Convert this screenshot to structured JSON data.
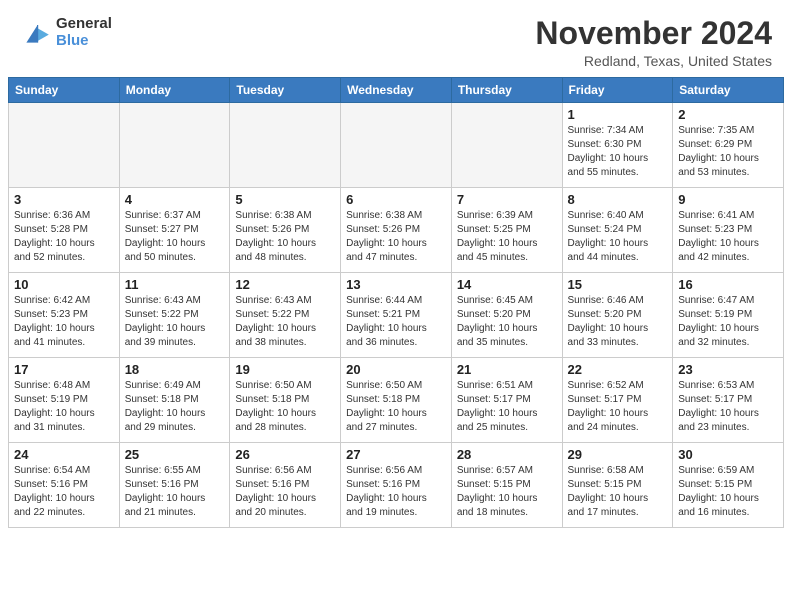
{
  "header": {
    "logo_general": "General",
    "logo_blue": "Blue",
    "month_title": "November 2024",
    "location": "Redland, Texas, United States"
  },
  "days_of_week": [
    "Sunday",
    "Monday",
    "Tuesday",
    "Wednesday",
    "Thursday",
    "Friday",
    "Saturday"
  ],
  "weeks": [
    [
      {
        "day": "",
        "info": ""
      },
      {
        "day": "",
        "info": ""
      },
      {
        "day": "",
        "info": ""
      },
      {
        "day": "",
        "info": ""
      },
      {
        "day": "",
        "info": ""
      },
      {
        "day": "1",
        "info": "Sunrise: 7:34 AM\nSunset: 6:30 PM\nDaylight: 10 hours and 55 minutes."
      },
      {
        "day": "2",
        "info": "Sunrise: 7:35 AM\nSunset: 6:29 PM\nDaylight: 10 hours and 53 minutes."
      }
    ],
    [
      {
        "day": "3",
        "info": "Sunrise: 6:36 AM\nSunset: 5:28 PM\nDaylight: 10 hours and 52 minutes."
      },
      {
        "day": "4",
        "info": "Sunrise: 6:37 AM\nSunset: 5:27 PM\nDaylight: 10 hours and 50 minutes."
      },
      {
        "day": "5",
        "info": "Sunrise: 6:38 AM\nSunset: 5:26 PM\nDaylight: 10 hours and 48 minutes."
      },
      {
        "day": "6",
        "info": "Sunrise: 6:38 AM\nSunset: 5:26 PM\nDaylight: 10 hours and 47 minutes."
      },
      {
        "day": "7",
        "info": "Sunrise: 6:39 AM\nSunset: 5:25 PM\nDaylight: 10 hours and 45 minutes."
      },
      {
        "day": "8",
        "info": "Sunrise: 6:40 AM\nSunset: 5:24 PM\nDaylight: 10 hours and 44 minutes."
      },
      {
        "day": "9",
        "info": "Sunrise: 6:41 AM\nSunset: 5:23 PM\nDaylight: 10 hours and 42 minutes."
      }
    ],
    [
      {
        "day": "10",
        "info": "Sunrise: 6:42 AM\nSunset: 5:23 PM\nDaylight: 10 hours and 41 minutes."
      },
      {
        "day": "11",
        "info": "Sunrise: 6:43 AM\nSunset: 5:22 PM\nDaylight: 10 hours and 39 minutes."
      },
      {
        "day": "12",
        "info": "Sunrise: 6:43 AM\nSunset: 5:22 PM\nDaylight: 10 hours and 38 minutes."
      },
      {
        "day": "13",
        "info": "Sunrise: 6:44 AM\nSunset: 5:21 PM\nDaylight: 10 hours and 36 minutes."
      },
      {
        "day": "14",
        "info": "Sunrise: 6:45 AM\nSunset: 5:20 PM\nDaylight: 10 hours and 35 minutes."
      },
      {
        "day": "15",
        "info": "Sunrise: 6:46 AM\nSunset: 5:20 PM\nDaylight: 10 hours and 33 minutes."
      },
      {
        "day": "16",
        "info": "Sunrise: 6:47 AM\nSunset: 5:19 PM\nDaylight: 10 hours and 32 minutes."
      }
    ],
    [
      {
        "day": "17",
        "info": "Sunrise: 6:48 AM\nSunset: 5:19 PM\nDaylight: 10 hours and 31 minutes."
      },
      {
        "day": "18",
        "info": "Sunrise: 6:49 AM\nSunset: 5:18 PM\nDaylight: 10 hours and 29 minutes."
      },
      {
        "day": "19",
        "info": "Sunrise: 6:50 AM\nSunset: 5:18 PM\nDaylight: 10 hours and 28 minutes."
      },
      {
        "day": "20",
        "info": "Sunrise: 6:50 AM\nSunset: 5:18 PM\nDaylight: 10 hours and 27 minutes."
      },
      {
        "day": "21",
        "info": "Sunrise: 6:51 AM\nSunset: 5:17 PM\nDaylight: 10 hours and 25 minutes."
      },
      {
        "day": "22",
        "info": "Sunrise: 6:52 AM\nSunset: 5:17 PM\nDaylight: 10 hours and 24 minutes."
      },
      {
        "day": "23",
        "info": "Sunrise: 6:53 AM\nSunset: 5:17 PM\nDaylight: 10 hours and 23 minutes."
      }
    ],
    [
      {
        "day": "24",
        "info": "Sunrise: 6:54 AM\nSunset: 5:16 PM\nDaylight: 10 hours and 22 minutes."
      },
      {
        "day": "25",
        "info": "Sunrise: 6:55 AM\nSunset: 5:16 PM\nDaylight: 10 hours and 21 minutes."
      },
      {
        "day": "26",
        "info": "Sunrise: 6:56 AM\nSunset: 5:16 PM\nDaylight: 10 hours and 20 minutes."
      },
      {
        "day": "27",
        "info": "Sunrise: 6:56 AM\nSunset: 5:16 PM\nDaylight: 10 hours and 19 minutes."
      },
      {
        "day": "28",
        "info": "Sunrise: 6:57 AM\nSunset: 5:15 PM\nDaylight: 10 hours and 18 minutes."
      },
      {
        "day": "29",
        "info": "Sunrise: 6:58 AM\nSunset: 5:15 PM\nDaylight: 10 hours and 17 minutes."
      },
      {
        "day": "30",
        "info": "Sunrise: 6:59 AM\nSunset: 5:15 PM\nDaylight: 10 hours and 16 minutes."
      }
    ]
  ]
}
